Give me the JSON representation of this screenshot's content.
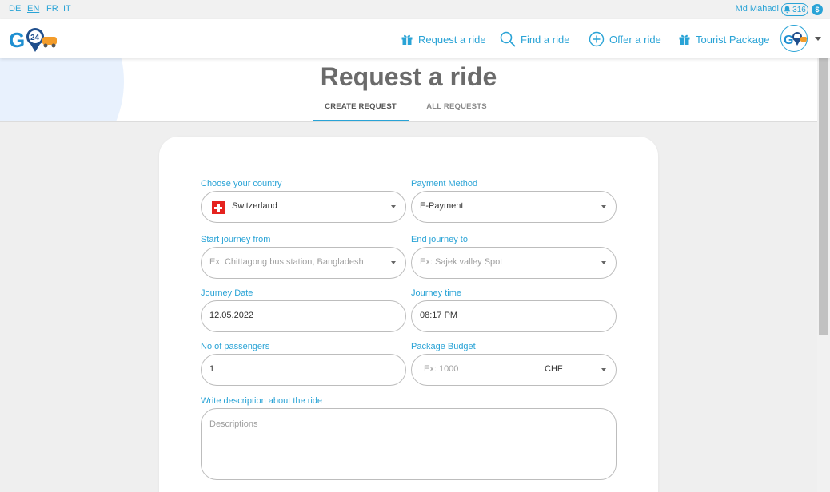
{
  "topbar": {
    "languages": [
      "DE",
      "EN",
      "FR",
      "IT"
    ],
    "active_language": "EN",
    "user_name": "Md Mahadi",
    "notification_count": "316",
    "coin_label": "$"
  },
  "nav": {
    "items": [
      {
        "label": "Request a ride",
        "icon": "gift-icon"
      },
      {
        "label": "Find a ride",
        "icon": "search-icon"
      },
      {
        "label": "Offer a ride",
        "icon": "plus-circle-icon"
      },
      {
        "label": "Tourist Package",
        "icon": "gift-icon"
      }
    ]
  },
  "page": {
    "title": "Request a ride",
    "tabs": [
      {
        "label": "CREATE REQUEST",
        "active": true
      },
      {
        "label": "ALL REQUESTS",
        "active": false
      }
    ]
  },
  "form": {
    "country": {
      "label": "Choose your country",
      "value": "Switzerland"
    },
    "payment": {
      "label": "Payment Method",
      "value": "E-Payment"
    },
    "start": {
      "label": "Start journey from",
      "placeholder": "Ex: Chittagong bus station, Bangladesh"
    },
    "end": {
      "label": "End journey to",
      "placeholder": "Ex: Sajek valley Spot"
    },
    "date": {
      "label": "Journey Date",
      "value": "12.05.2022"
    },
    "time": {
      "label": "Journey time",
      "value": "08:17 PM"
    },
    "passengers": {
      "label": "No of passengers",
      "value": "1"
    },
    "budget": {
      "label": "Package Budget",
      "placeholder": "Ex: 1000",
      "currency": "CHF"
    },
    "description": {
      "label": "Write description about the ride",
      "placeholder": "Descriptions"
    }
  },
  "colors": {
    "accent": "#29a3d6",
    "title": "#6b6b6b",
    "background": "#efefef",
    "flag_red": "#e5231f"
  }
}
